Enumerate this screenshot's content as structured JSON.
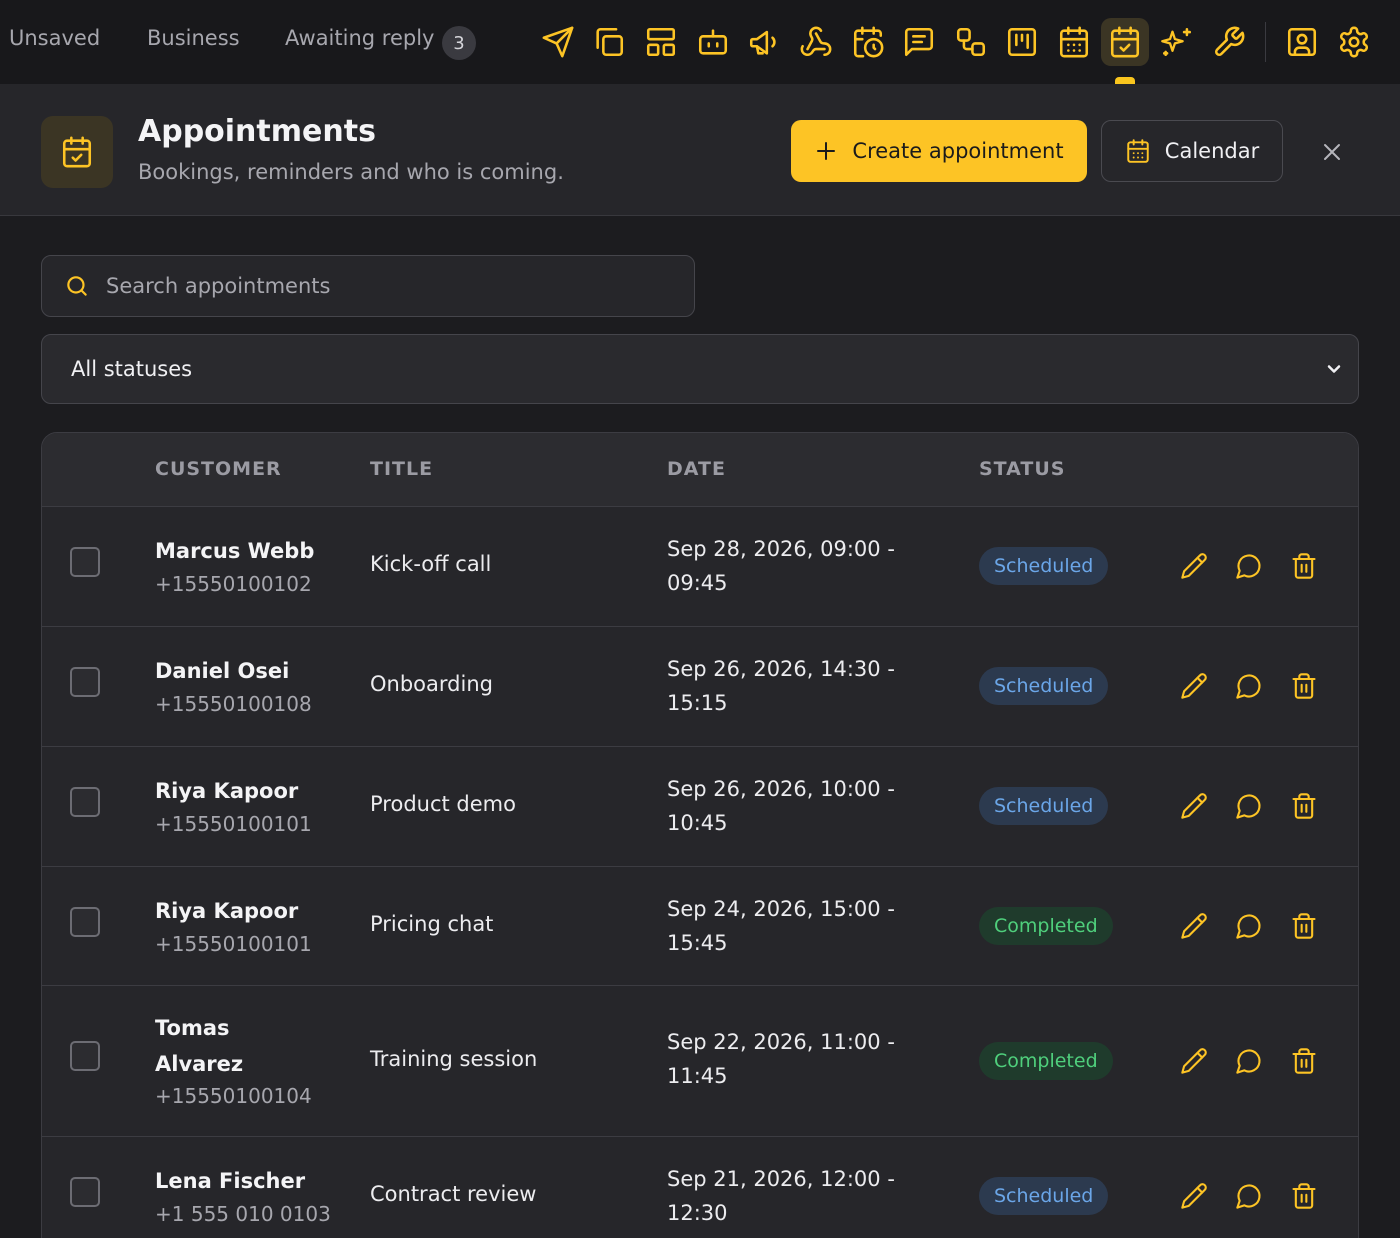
{
  "topnav": {
    "tabs": [
      {
        "label": "Unsaved"
      },
      {
        "label": "Business"
      },
      {
        "label": "Awaiting reply",
        "badge": "3"
      }
    ],
    "tools": [
      "send-icon",
      "copy-icon",
      "layout-icon",
      "bot-icon",
      "megaphone-icon",
      "webhook-icon",
      "calendar-clock-icon",
      "message-square-icon",
      "workflow-icon",
      "kanban-icon",
      "calendar-grid-icon",
      "calendar-check-icon",
      "sparkles-icon",
      "wrench-icon",
      "contact-icon",
      "settings-icon"
    ],
    "active_tool": "calendar-check-icon"
  },
  "header": {
    "title": "Appointments",
    "subtitle": "Bookings, reminders and who is coming.",
    "create_label": "Create appointment",
    "calendar_label": "Calendar"
  },
  "search": {
    "placeholder": "Search appointments",
    "value": ""
  },
  "status_filter": {
    "value": "All statuses"
  },
  "table": {
    "columns": [
      "CUSTOMER",
      "TITLE",
      "DATE",
      "STATUS"
    ],
    "rows": [
      {
        "name": "Marcus Webb",
        "phone": "+15550100102",
        "title": "Kick-off call",
        "date_line1": "Sep 28, 2026, 09:00 -",
        "date_line2": "09:45",
        "status": "Scheduled"
      },
      {
        "name": "Daniel Osei",
        "phone": "+15550100108",
        "title": "Onboarding",
        "date_line1": "Sep 26, 2026, 14:30 -",
        "date_line2": "15:15",
        "status": "Scheduled"
      },
      {
        "name": "Riya Kapoor",
        "phone": "+15550100101",
        "title": "Product demo",
        "date_line1": "Sep 26, 2026, 10:00 -",
        "date_line2": "10:45",
        "status": "Scheduled"
      },
      {
        "name": "Riya Kapoor",
        "phone": "+15550100101",
        "title": "Pricing chat",
        "date_line1": "Sep 24, 2026, 15:00 -",
        "date_line2": "15:45",
        "status": "Completed"
      },
      {
        "name": "Tomas Alvarez",
        "phone": "+15550100104",
        "title": "Training session",
        "date_line1": "Sep 22, 2026, 11:00 -",
        "date_line2": "11:45",
        "status": "Completed"
      },
      {
        "name": "Lena Fischer",
        "phone": "+1 555 010 0103",
        "title": "Contract review",
        "date_line1": "Sep 21, 2026, 12:00 -",
        "date_line2": "12:30",
        "status": "Scheduled"
      }
    ]
  },
  "colors": {
    "accent": "#fdc425",
    "scheduled_bg": "#2c3a4f",
    "scheduled_fg": "#6ba6e8",
    "completed_bg": "#1f3b2c",
    "completed_fg": "#4fcf7c"
  }
}
